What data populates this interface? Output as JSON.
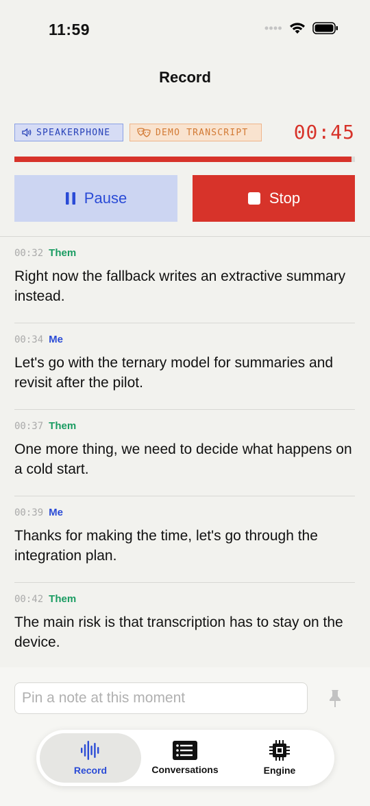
{
  "status_bar": {
    "time": "11:59"
  },
  "nav": {
    "title": "Record"
  },
  "badges": {
    "speakerphone": {
      "label": "SPEAKERPHONE",
      "icon": "speaker-icon"
    },
    "demo": {
      "label": "DEMO TRANSCRIPT",
      "icon": "theater-masks-icon"
    }
  },
  "timer": "00:45",
  "progress": {
    "fraction": 0.99,
    "color": "#d7332a"
  },
  "controls": {
    "pause_label": "Pause",
    "stop_label": "Stop"
  },
  "transcript": [
    {
      "time": "00:32",
      "speaker": "Them",
      "text": "Right now the fallback writes an extractive summary instead."
    },
    {
      "time": "00:34",
      "speaker": "Me",
      "text": "Let's go with the ternary model for summaries and revisit after the pilot."
    },
    {
      "time": "00:37",
      "speaker": "Them",
      "text": "One more thing, we need to decide what happens on a cold start."
    },
    {
      "time": "00:39",
      "speaker": "Me",
      "text": "Thanks for making the time, let's go through the integration plan."
    },
    {
      "time": "00:42",
      "speaker": "Them",
      "text": "The main risk is that transcription has to stay on the device."
    }
  ],
  "note": {
    "placeholder": "Pin a note at this moment",
    "value": ""
  },
  "tabs": [
    {
      "label": "Record",
      "icon": "waveform-icon",
      "selected": true
    },
    {
      "label": "Conversations",
      "icon": "list-icon",
      "selected": false
    },
    {
      "label": "Engine",
      "icon": "chip-icon",
      "selected": false
    }
  ],
  "colors": {
    "accent_blue": "#2a4bd6",
    "record_red": "#d7332a",
    "them_green": "#1a9c62",
    "demo_orange": "#d27a34"
  }
}
